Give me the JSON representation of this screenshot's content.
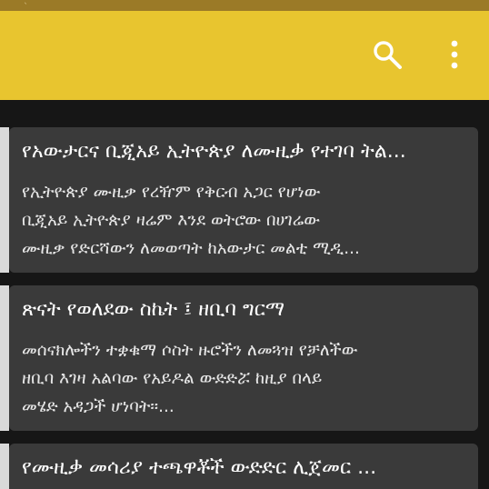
{
  "colors": {
    "status_bar": "#9b7a27",
    "toolbar": "#e8c52f",
    "feed_background": "#161616",
    "card_background": "#3a3a3a",
    "card_accent": "#d9d9d9",
    "title_text": "#ffffff",
    "summary_text": "#e6e6e6"
  },
  "status_bar": {
    "partial_glyph": "ˎ"
  },
  "toolbar": {
    "search_icon": "search-icon",
    "overflow_icon": "more-vert-icon"
  },
  "articles": [
    {
      "title": "የአውታርና ቢጂአይ ኢትዮጵያ ለሙዚቃ የተገባ ትል...",
      "summary_lines": [
        "የኢትዮጵያ ሙዚቃ የረዥም የቅርብ አጋር የሆነው",
        "ቢጂአይ ኢትዮጵያ ዛሬም እንደ ወትሮው በሀገሬው",
        "ሙዚቃ የድርሻውን ለመወጣት ከአውታር መልቲ ሚዲ..."
      ]
    },
    {
      "title": "ጽናት የወለደው ስኬት ፤ ዘቢባ ግርማ",
      "summary_lines": [
        "መሰናክሎችን ተቋቁማ ሶስት ዙሮችን ለመጓዝ የቻለችው",
        "ዘቢባ እገዛ አልባው የአይዶል ውድድሯ ከዚያ በላይ",
        "መሄድ አዳጋች ሆነባት፡፡..."
      ]
    },
    {
      "title": "የሙዚቃ መሳሪያ ተጫዋቾች ውድድር ሊጀመር ...",
      "summary_lines": []
    }
  ]
}
